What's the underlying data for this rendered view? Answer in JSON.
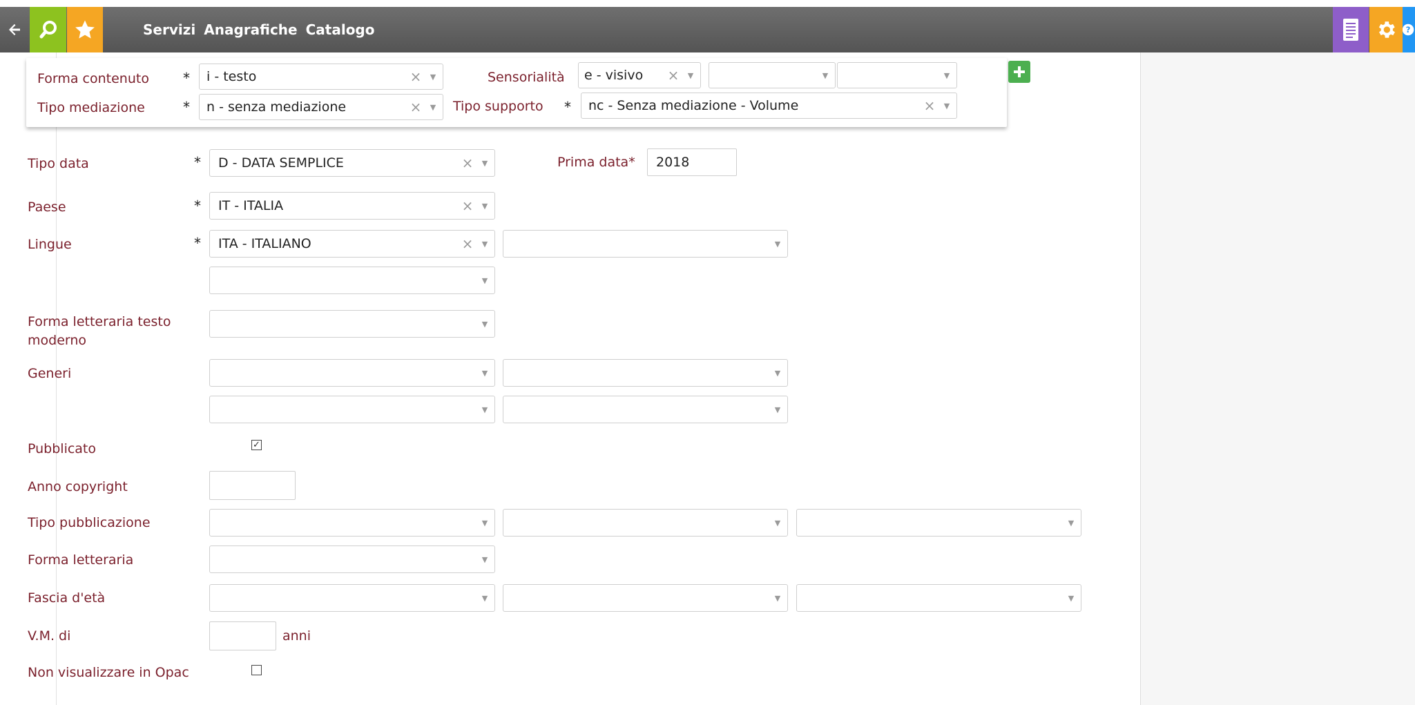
{
  "topbar": {
    "menu": [
      "Servizi",
      "Anagrafiche",
      "Catalogo"
    ],
    "colors": {
      "back": "#6a6a6a",
      "search": "#8dc21f",
      "star": "#f5a623",
      "list": "#8e5ec9",
      "gear": "#f5a623",
      "help": "#2196f3"
    }
  },
  "popup": {
    "forma_contenuto": {
      "label": "Forma contenuto",
      "required": "*",
      "value": "i - testo"
    },
    "tipo_mediazione": {
      "label": "Tipo mediazione",
      "required": "*",
      "value": "n - senza mediazione"
    },
    "sensorialita": {
      "label": "Sensorialità",
      "value": "e - visivo",
      "value2": "",
      "value3": ""
    },
    "tipo_supporto": {
      "label": "Tipo supporto",
      "required": "*",
      "value": "nc - Senza mediazione - Volume"
    }
  },
  "form": {
    "tipo_data": {
      "label": "Tipo data",
      "required": "*",
      "value": "D - DATA SEMPLICE"
    },
    "prima_data": {
      "label": "Prima data*",
      "value": "2018"
    },
    "paese": {
      "label": "Paese",
      "required": "*",
      "value": "IT - ITALIA"
    },
    "lingue": {
      "label": "Lingue",
      "required": "*",
      "value": "ITA - ITALIANO",
      "value2": "",
      "value3": ""
    },
    "forma_letteraria_testo_moderno": {
      "label_line1": "Forma letteraria testo",
      "label_line2": "moderno",
      "value": ""
    },
    "generi": {
      "label": "Generi",
      "values": [
        "",
        "",
        "",
        ""
      ]
    },
    "pubblicato": {
      "label": "Pubblicato",
      "checked": true
    },
    "anno_copyright": {
      "label": "Anno copyright",
      "value": ""
    },
    "tipo_pubblicazione": {
      "label": "Tipo pubblicazione",
      "values": [
        "",
        "",
        ""
      ]
    },
    "forma_letteraria": {
      "label": "Forma letteraria",
      "value": ""
    },
    "fascia_eta": {
      "label": "Fascia d'età",
      "values": [
        "",
        "",
        ""
      ]
    },
    "vm": {
      "label": "V.M. di",
      "value": "",
      "unit": "anni"
    },
    "non_visualizzare_opac": {
      "label": "Non visualizzare in Opac",
      "checked": false
    }
  },
  "glyphs": {
    "clear": "×",
    "arrow": "▼",
    "check": "✓"
  }
}
